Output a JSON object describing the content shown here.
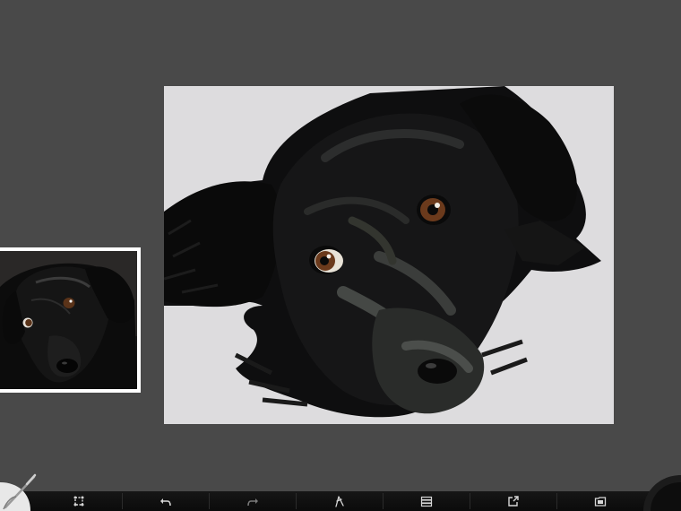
{
  "app": {
    "name": "painting-app"
  },
  "colors": {
    "workspace": "#494949",
    "paper": "#dddcde",
    "toolbar": "#111111",
    "icon": "#d7d7d7",
    "dog_fur": "#0f0f10",
    "dog_eye": "#6b3a1c"
  },
  "reference_panel": {
    "icon": "reference-photo"
  },
  "toolbar": {
    "buttons": [
      {
        "id": "transform",
        "icon": "transform-icon"
      },
      {
        "id": "undo",
        "icon": "undo-icon"
      },
      {
        "id": "redo",
        "icon": "redo-icon"
      },
      {
        "id": "brush-settings",
        "icon": "calligraphy-brush-icon"
      },
      {
        "id": "layers",
        "icon": "layers-icon"
      },
      {
        "id": "export",
        "icon": "share-icon"
      },
      {
        "id": "gallery",
        "icon": "gallery-icon"
      }
    ]
  },
  "corners": {
    "left": "brush-tool-icon",
    "right": "color-picker-icon"
  }
}
